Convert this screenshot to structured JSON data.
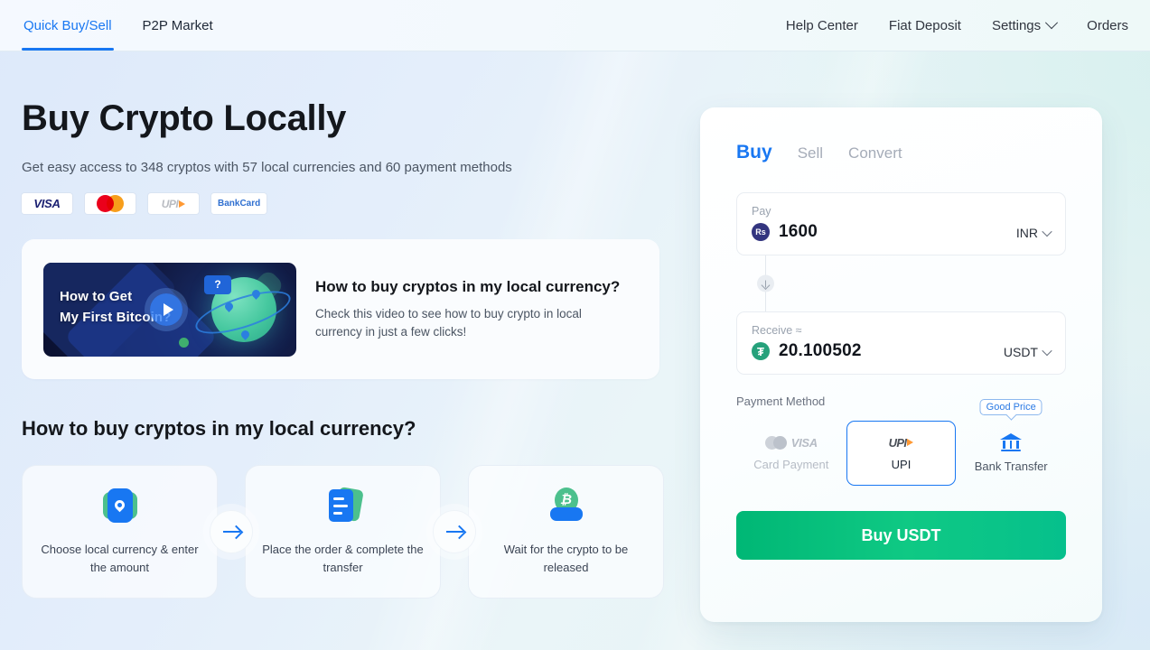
{
  "nav": {
    "tabs": [
      {
        "label": "Quick Buy/Sell",
        "active": true
      },
      {
        "label": "P2P Market",
        "active": false
      }
    ],
    "links": [
      {
        "label": "Help Center",
        "caret": false
      },
      {
        "label": "Fiat Deposit",
        "caret": false
      },
      {
        "label": "Settings",
        "caret": true
      },
      {
        "label": "Orders",
        "caret": false
      }
    ]
  },
  "hero": {
    "title": "Buy Crypto Locally",
    "subtitle": "Get easy access to 348 cryptos with 57 local currencies and 60 payment methods",
    "logos": [
      {
        "name": "visa-logo",
        "text": "VISA"
      },
      {
        "name": "mastercard-logo",
        "text": ""
      },
      {
        "name": "upi-logo",
        "text": "UPI"
      },
      {
        "name": "bankcard-logo",
        "text": "BankCard"
      }
    ]
  },
  "video": {
    "thumb_line1": "How to Get",
    "thumb_line2": "My First Bitcoin?",
    "bubble": "?",
    "heading": "How to buy cryptos in my local currency?",
    "description": "Check this video to see how to buy crypto in local currency in just a few clicks!"
  },
  "steps_section": {
    "title": "How to buy cryptos in my local currency?",
    "steps": [
      {
        "icon": "location-card-icon",
        "label": "Choose local currency & enter the amount"
      },
      {
        "icon": "document-icon",
        "label": "Place the order & complete the transfer"
      },
      {
        "icon": "bitcoin-release-icon",
        "label": "Wait for the crypto to be released"
      }
    ]
  },
  "panel": {
    "tabs": [
      {
        "label": "Buy",
        "active": true
      },
      {
        "label": "Sell",
        "active": false
      },
      {
        "label": "Convert",
        "active": false
      }
    ],
    "pay": {
      "label": "Pay",
      "value": "1600",
      "currency": "INR",
      "coin_symbol": "Rs"
    },
    "receive": {
      "label": "Receive ≈",
      "value": "20.100502",
      "currency": "USDT",
      "coin_symbol": "₮"
    },
    "payment_method": {
      "label": "Payment Method",
      "options": [
        {
          "name": "Card Payment",
          "icon": "visa-grey-icon",
          "state": "disabled",
          "badge": ""
        },
        {
          "name": "UPI",
          "icon": "upi-icon",
          "state": "selected",
          "badge": ""
        },
        {
          "name": "Bank Transfer",
          "icon": "bank-icon",
          "state": "default",
          "badge": "Good Price"
        }
      ]
    },
    "submit_label": "Buy USDT"
  },
  "colors": {
    "accent_blue": "#1877f2",
    "accent_green": "#0fc984",
    "text_dark": "#14171c",
    "text_muted": "#6b7280",
    "usdt_green": "#26a17b",
    "inr_navy": "#33357f"
  }
}
